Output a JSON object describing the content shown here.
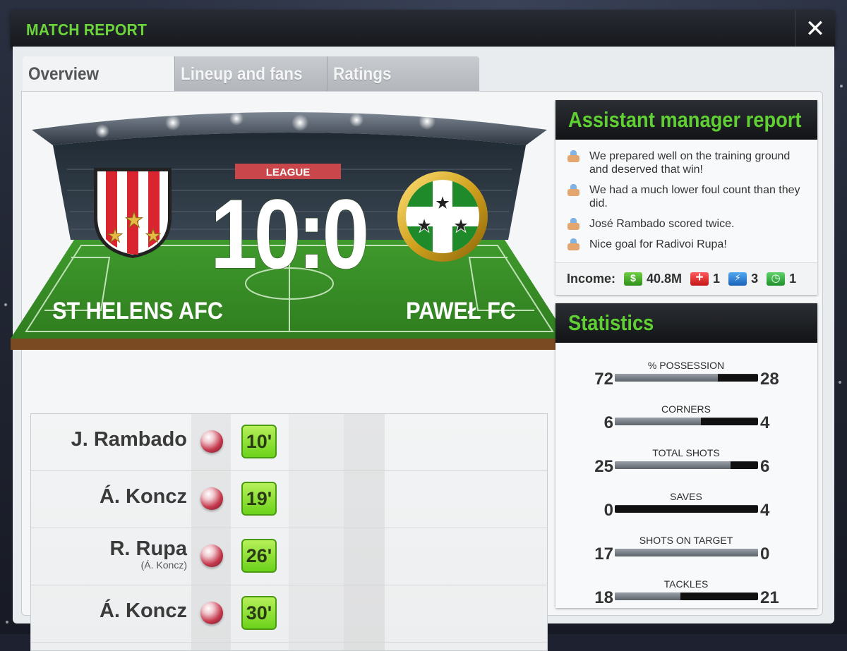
{
  "header": {
    "title": "MATCH REPORT",
    "close_label": "✕"
  },
  "tabs": [
    {
      "label": "Overview",
      "active": true
    },
    {
      "label": "Lineup and fans",
      "active": false
    },
    {
      "label": "Ratings",
      "active": false
    }
  ],
  "match": {
    "competition": "LEAGUE",
    "score": "10:0",
    "home_team": "ST HELENS AFC",
    "away_team": "PAWEŁ FC"
  },
  "goals": [
    {
      "scorer": "J. Rambado",
      "assist": "",
      "minute": "10'"
    },
    {
      "scorer": "Á. Koncz",
      "assist": "",
      "minute": "19'"
    },
    {
      "scorer": "R. Rupa",
      "assist": "(Á. Koncz)",
      "minute": "26'"
    },
    {
      "scorer": "Á. Koncz",
      "assist": "",
      "minute": "30'"
    }
  ],
  "assistant_report": {
    "title": "Assistant manager report",
    "items": [
      "We prepared well on the training ground and deserved that win!",
      "We had a much lower foul count than they did.",
      "José Rambado scored twice.",
      "Nice goal for Radivoi Rupa!"
    ],
    "income_label": "Income:",
    "income_money": "40.8M",
    "medical": "1",
    "energy": "3",
    "time": "1"
  },
  "statistics": {
    "title": "Statistics",
    "rows": [
      {
        "label": "% POSSESSION",
        "home": "72",
        "away": "28",
        "home_share": 0.72
      },
      {
        "label": "CORNERS",
        "home": "6",
        "away": "4",
        "home_share": 0.6
      },
      {
        "label": "TOTAL SHOTS",
        "home": "25",
        "away": "6",
        "home_share": 0.81
      },
      {
        "label": "SAVES",
        "home": "0",
        "away": "4",
        "home_share": 0.0
      },
      {
        "label": "SHOTS ON TARGET",
        "home": "17",
        "away": "0",
        "home_share": 1.0
      },
      {
        "label": "TACKLES",
        "home": "18",
        "away": "21",
        "home_share": 0.46
      }
    ]
  },
  "colors": {
    "accent_green": "#5fcf33",
    "home_red": "#d9252f",
    "away_green": "#1f8a2a",
    "minute_green": "#8ee23a"
  }
}
